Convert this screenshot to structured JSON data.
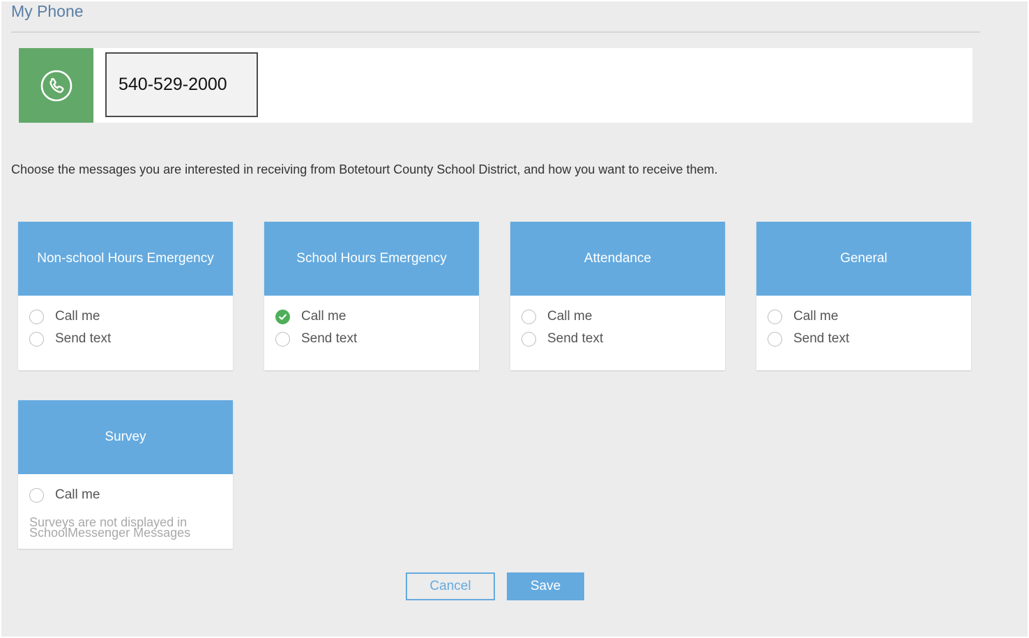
{
  "page": {
    "title": "My Phone"
  },
  "phone": {
    "number": "540-529-2000",
    "icon": "phone-icon"
  },
  "instructions": "Choose the messages you are interested in receiving from Botetourt County School District, and how you want to receive them.",
  "categories": [
    {
      "title": "Non-school Hours Emergency",
      "call_label": "Call me",
      "text_label": "Send text",
      "call_checked": false,
      "text_checked": false
    },
    {
      "title": "School Hours Emergency",
      "call_label": "Call me",
      "text_label": "Send text",
      "call_checked": true,
      "text_checked": false
    },
    {
      "title": "Attendance",
      "call_label": "Call me",
      "text_label": "Send text",
      "call_checked": false,
      "text_checked": false
    },
    {
      "title": "General",
      "call_label": "Call me",
      "text_label": "Send text",
      "call_checked": false,
      "text_checked": false
    },
    {
      "title": "Survey",
      "call_label": "Call me",
      "call_checked": false,
      "note": "Surveys are not displayed in SchoolMessenger Messages"
    }
  ],
  "actions": {
    "cancel_label": "Cancel",
    "save_label": "Save"
  },
  "colors": {
    "accent": "#64aadf",
    "phone_icon_bg": "#62a868",
    "check": "#4fae5a",
    "title": "#5a7ea6",
    "background": "#ececec"
  }
}
